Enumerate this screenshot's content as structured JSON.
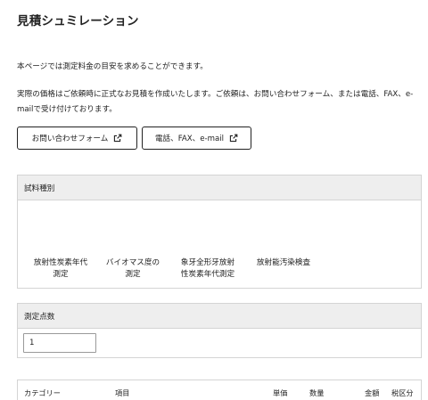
{
  "page": {
    "title": "見積シュミレーション",
    "intro": "本ページでは測定料金の目安を求めることができます。",
    "description": "実際の価格はご依頼時に正式なお見積を作成いたします。ご依頼は、お問い合わせフォーム、または電話、FAX、e-mailで受け付けております。"
  },
  "buttons": {
    "contact_form": "お問い合わせフォーム",
    "phone_fax_email": "電話、FAX、e-mail",
    "icon": "external-link-icon"
  },
  "sample_type": {
    "header": "試料種別",
    "options": [
      "放射性炭素年代\n測定",
      "バイオマス度の\n測定",
      "象牙全形牙放射\n性炭素年代測定",
      "放射能汚染検査"
    ]
  },
  "measurement_count": {
    "header": "測定点数",
    "value": "1"
  },
  "table": {
    "headers": [
      "カテゴリー",
      "項目",
      "単価",
      "数量",
      "金額",
      "税区分"
    ]
  }
}
